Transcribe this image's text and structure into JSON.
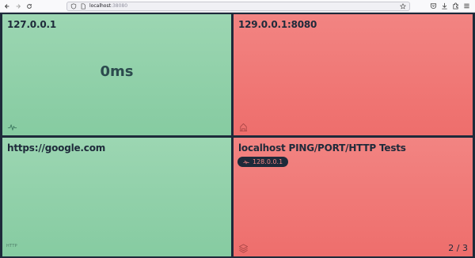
{
  "browser": {
    "url_host": "localhost",
    "url_port": ":38080"
  },
  "tiles": [
    {
      "title": "127.0.0.1",
      "value": "0ms",
      "status": "up",
      "icon": "pulse-icon"
    },
    {
      "title": "129.0.0.1:8080",
      "status": "down",
      "icon": "plug-icon"
    },
    {
      "title": "https://google.com",
      "status": "up",
      "label": "HTTP"
    },
    {
      "title": "localhost PING/PORT/HTTP Tests",
      "status": "down",
      "badge": "128.0.0.1",
      "icon": "layers-icon",
      "page": "2 / 3"
    }
  ],
  "colors": {
    "up": "#9cd6b2",
    "down": "#f28482",
    "background": "#1e2a3a"
  }
}
